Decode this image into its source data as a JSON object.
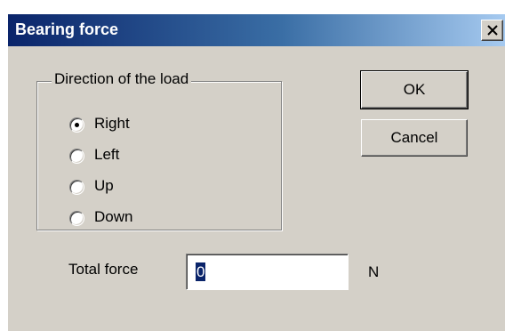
{
  "window": {
    "title": "Bearing force",
    "close_icon": "close-icon"
  },
  "direction_group": {
    "label": "Direction of the load",
    "options": [
      {
        "label": "Right",
        "selected": true
      },
      {
        "label": "Left",
        "selected": false
      },
      {
        "label": "Up",
        "selected": false
      },
      {
        "label": "Down",
        "selected": false
      }
    ]
  },
  "buttons": {
    "ok_label": "OK",
    "cancel_label": "Cancel"
  },
  "total_force": {
    "label": "Total force",
    "value": "0",
    "unit": "N"
  },
  "colors": {
    "title_bar_start": "#0a246a",
    "title_bar_end": "#a6caf0",
    "dialog_face": "#d4d0c8",
    "selection": "#0a246a"
  }
}
